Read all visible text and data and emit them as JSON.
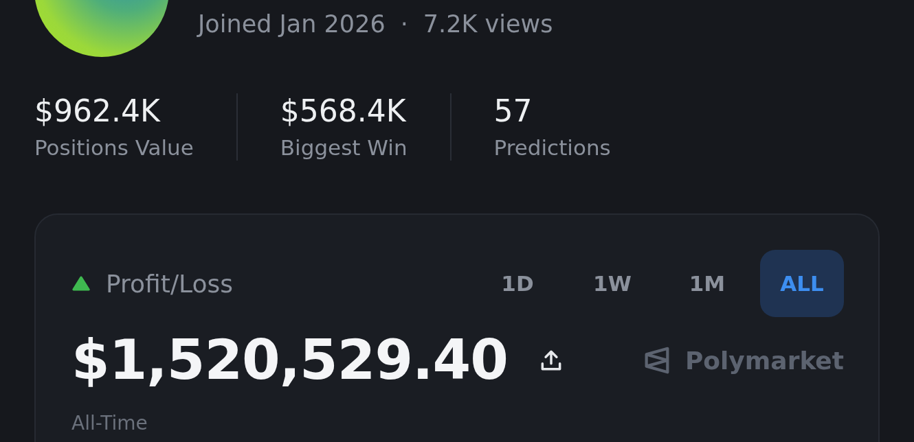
{
  "profile": {
    "joined": "Joined Jan 2026",
    "separator": "·",
    "views": "7.2K views"
  },
  "stats": [
    {
      "value": "$962.4K",
      "label": "Positions Value"
    },
    {
      "value": "$568.4K",
      "label": "Biggest Win"
    },
    {
      "value": "57",
      "label": "Predictions"
    }
  ],
  "pnl_card": {
    "positive": true,
    "title": "Profit/Loss",
    "ranges": [
      {
        "label": "1D",
        "selected": false
      },
      {
        "label": "1W",
        "selected": false
      },
      {
        "label": "1M",
        "selected": false
      },
      {
        "label": "ALL",
        "selected": true
      }
    ],
    "amount": "$1,520,529.40",
    "brand": "Polymarket",
    "period": "All-Time"
  }
}
